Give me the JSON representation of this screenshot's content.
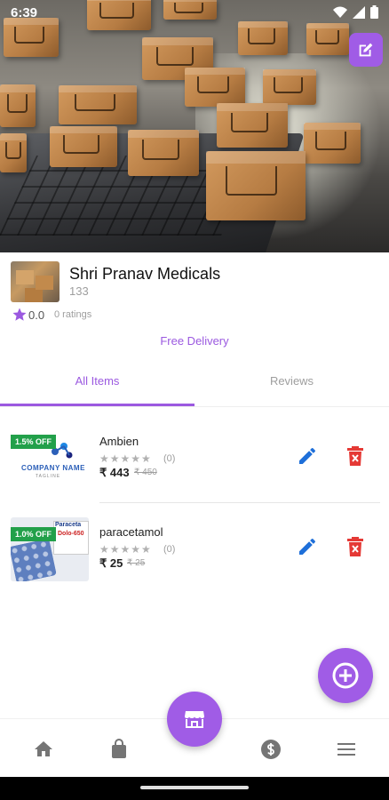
{
  "status_bar": {
    "time": "6:39"
  },
  "store": {
    "name": "Shri Pranav Medicals",
    "id": "133",
    "rating_value": "0.0",
    "rating_count": "0 ratings",
    "delivery": "Free Delivery"
  },
  "tabs": [
    {
      "label": "All Items",
      "active": true
    },
    {
      "label": "Reviews",
      "active": false
    }
  ],
  "products": [
    {
      "name": "Ambien",
      "discount": "1.5% OFF",
      "stars": "★★★★★",
      "reviews": "(0)",
      "price": "₹ 443",
      "mrp": "₹ 450",
      "thumb_logo": "COMPANY NAME",
      "thumb_sub": "TAGLINE"
    },
    {
      "name": "paracetamol",
      "discount": "1.0% OFF",
      "stars": "★★★★★",
      "reviews": "(0)",
      "price": "₹ 25",
      "mrp": "₹ 25",
      "thumb_title": "Paraceta",
      "thumb_sub": "Dolo-650"
    }
  ],
  "colors": {
    "accent": "#a05ce6",
    "accent_text": "#9b59e0",
    "discount_badge": "#22a04a",
    "delete": "#e53935",
    "edit": "#1e6fd9"
  },
  "icons": {
    "edit_cover": "edit-square-icon",
    "edit": "pencil-icon",
    "delete": "delete-icon",
    "add": "add-circle-icon",
    "nav": [
      "home-icon",
      "shopping-bag-icon",
      "storefront-icon",
      "dollar-icon",
      "menu-icon"
    ]
  }
}
